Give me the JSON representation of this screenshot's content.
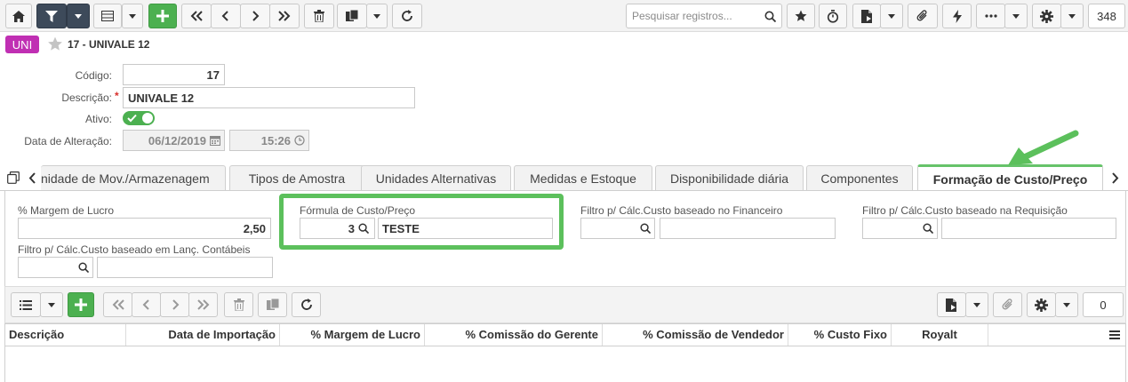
{
  "toolbar": {
    "search_placeholder": "Pesquisar registros...",
    "record_count": "348",
    "icons": [
      "home-icon",
      "filter-icon",
      "view-icon",
      "add-icon",
      "first-icon",
      "prev-icon",
      "next-icon",
      "last-icon",
      "delete-icon",
      "copy-icon",
      "refresh-icon",
      "search-icon",
      "star-icon",
      "timer-icon",
      "report-icon",
      "attach-icon",
      "flash-icon",
      "more-icon",
      "gear-icon"
    ]
  },
  "header": {
    "badge": "UNI",
    "title": "17 - UNIVALE 12"
  },
  "form": {
    "codigo_label": "Código:",
    "codigo_value": "17",
    "descricao_label": "Descrição:",
    "descricao_required": "*",
    "descricao_value": "UNIVALE 12",
    "ativo_label": "Ativo:",
    "data_label": "Data de Alteração:",
    "data_value": "06/12/2019",
    "hora_value": "15:26"
  },
  "tabs": [
    {
      "label": "nidade de Mov./Armazenagem"
    },
    {
      "label": "Tipos de Amostra"
    },
    {
      "label": "Unidades Alternativas"
    },
    {
      "label": "Medidas e Estoque"
    },
    {
      "label": "Disponibilidade diária"
    },
    {
      "label": "Componentes"
    },
    {
      "label": "Formação de Custo/Preço"
    }
  ],
  "panel": {
    "margem_label": "% Margem de Lucro",
    "margem_value": "2,50",
    "formula_label": "Fórmula de Custo/Preço",
    "formula_code": "3",
    "formula_desc": "TESTE",
    "filtro_fin_label": "Filtro p/ Cálc.Custo baseado no Financeiro",
    "filtro_req_label": "Filtro p/ Cálc.Custo baseado na Requisição",
    "filtro_lanc_label": "Filtro p/ Cálc.Custo baseado em Lanç. Contábeis"
  },
  "grid": {
    "count": "0",
    "columns": [
      "Descrição",
      "Data de Importação",
      "% Margem de Lucro",
      "% Comissão do Gerente",
      "% Comissão de Vendedor",
      "% Custo Fixo",
      "Royalt"
    ]
  },
  "colors": {
    "accent_green": "#4cb050",
    "highlight_green": "#5cc05c",
    "badge_purple": "#c02fb3",
    "toolbar_dark": "#3d4a5a"
  }
}
